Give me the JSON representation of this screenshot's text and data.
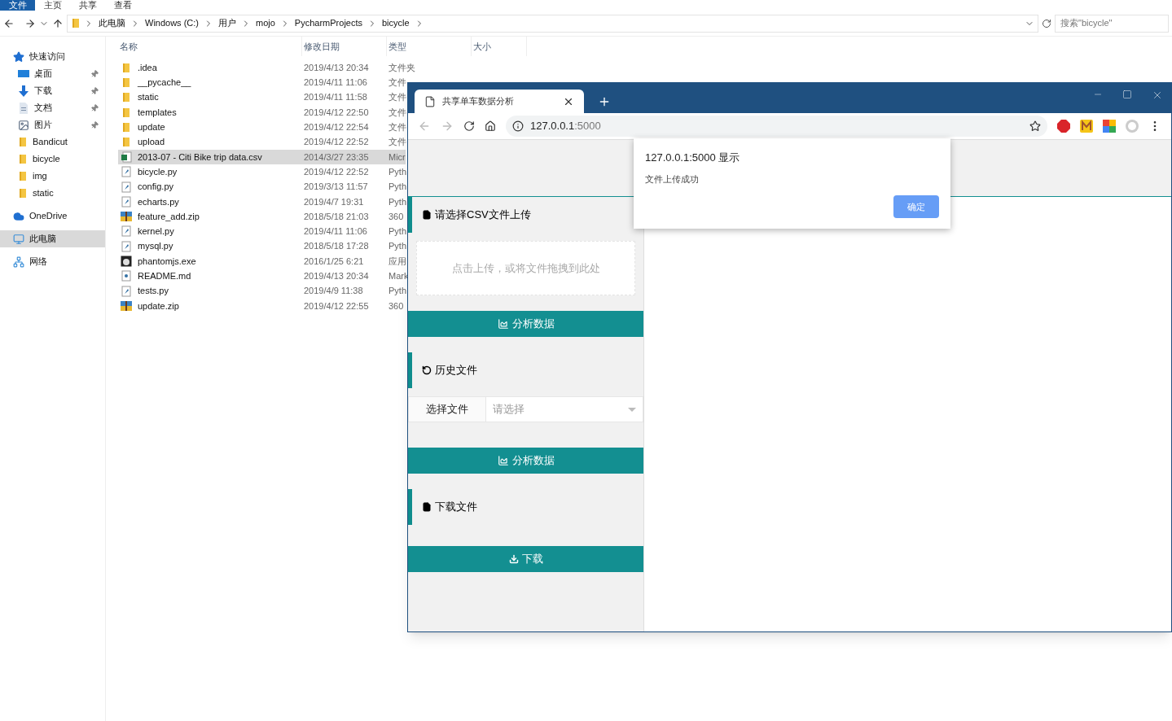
{
  "explorer": {
    "ribbon_tabs": [
      {
        "label": "文件",
        "selected": true
      },
      {
        "label": "主页",
        "selected": false
      },
      {
        "label": "共享",
        "selected": false
      },
      {
        "label": "查看",
        "selected": false
      }
    ],
    "address_path": [
      "此电脑",
      "Windows (C:)",
      "用户",
      "mojo",
      "PycharmProjects",
      "bicycle"
    ],
    "search": {
      "placeholder": "搜索\"bicycle\""
    },
    "sidebar": [
      {
        "label": "快速访问",
        "kind": "star",
        "selected": false,
        "children": [
          {
            "label": "桌面",
            "kind": "desktop",
            "pinned": true,
            "selected": false
          },
          {
            "label": "下载",
            "kind": "download",
            "pinned": true,
            "selected": false
          },
          {
            "label": "文档",
            "kind": "document",
            "pinned": true,
            "selected": false
          },
          {
            "label": "图片",
            "kind": "pictures",
            "pinned": true,
            "selected": false
          },
          {
            "label": "Bandicut",
            "kind": "folder",
            "pinned": false,
            "selected": false
          },
          {
            "label": "bicycle",
            "kind": "folder",
            "pinned": false,
            "selected": false
          },
          {
            "label": "img",
            "kind": "folder",
            "pinned": false,
            "selected": false
          },
          {
            "label": "static",
            "kind": "folder",
            "pinned": false,
            "selected": false
          }
        ]
      },
      {
        "label": "OneDrive",
        "kind": "cloud",
        "selected": false
      },
      {
        "label": "此电脑",
        "kind": "computer",
        "selected": true
      },
      {
        "label": "网络",
        "kind": "network",
        "selected": false
      }
    ],
    "columns": [
      "名称",
      "修改日期",
      "类型",
      "大小"
    ],
    "rows": [
      {
        "name": ".idea",
        "date": "2019/4/13 20:34",
        "type": "文件夹",
        "kind": "folder",
        "selected": false
      },
      {
        "name": "__pycache__",
        "date": "2019/4/11 11:06",
        "type": "文件",
        "kind": "folder",
        "selected": false
      },
      {
        "name": "static",
        "date": "2019/4/11 11:58",
        "type": "文件",
        "kind": "folder",
        "selected": false
      },
      {
        "name": "templates",
        "date": "2019/4/12 22:50",
        "type": "文件",
        "kind": "folder",
        "selected": false
      },
      {
        "name": "update",
        "date": "2019/4/12 22:54",
        "type": "文件",
        "kind": "folder",
        "selected": false
      },
      {
        "name": "upload",
        "date": "2019/4/12 22:52",
        "type": "文件",
        "kind": "folder",
        "selected": false
      },
      {
        "name": "2013-07 - Citi Bike trip data.csv",
        "date": "2014/3/27 23:35",
        "type": "Micr",
        "kind": "csv",
        "selected": true
      },
      {
        "name": "bicycle.py",
        "date": "2019/4/12 22:52",
        "type": "Pyth",
        "kind": "py",
        "selected": false
      },
      {
        "name": "config.py",
        "date": "2019/3/13 11:57",
        "type": "Pyth",
        "kind": "py",
        "selected": false
      },
      {
        "name": "echarts.py",
        "date": "2019/4/7 19:31",
        "type": "Pyth",
        "kind": "py",
        "selected": false
      },
      {
        "name": "feature_add.zip",
        "date": "2018/5/18 21:03",
        "type": "360",
        "kind": "zip",
        "selected": false
      },
      {
        "name": "kernel.py",
        "date": "2019/4/11 11:06",
        "type": "Pyth",
        "kind": "py",
        "selected": false
      },
      {
        "name": "mysql.py",
        "date": "2018/5/18 17:28",
        "type": "Pyth",
        "kind": "py",
        "selected": false
      },
      {
        "name": "phantomjs.exe",
        "date": "2016/1/25 6:21",
        "type": "应用",
        "kind": "exe",
        "selected": false
      },
      {
        "name": "README.md",
        "date": "2019/4/13 20:34",
        "type": "Mark",
        "kind": "md",
        "selected": false
      },
      {
        "name": "tests.py",
        "date": "2019/4/9 11:38",
        "type": "Pyth",
        "kind": "py",
        "selected": false
      },
      {
        "name": "update.zip",
        "date": "2019/4/12 22:55",
        "type": "360",
        "kind": "zip",
        "selected": false
      }
    ]
  },
  "browser": {
    "tab_title": "共享单车数据分析",
    "url_host": "127.0.0.1",
    "url_port": ":5000",
    "dialog": {
      "title": "127.0.0.1:5000 显示",
      "message": "文件上传成功",
      "button": "确定"
    },
    "sections": [
      {
        "kind": "upload",
        "header": "请选择CSV文件上传",
        "dropzone": "点击上传，或将文件拖拽到此处",
        "button": "分析数据"
      },
      {
        "kind": "history",
        "header": "历史文件",
        "select_label": "选择文件",
        "select_placeholder": "请选择",
        "button": "分析数据"
      },
      {
        "kind": "download",
        "header": "下载文件",
        "button": "下载"
      }
    ]
  }
}
